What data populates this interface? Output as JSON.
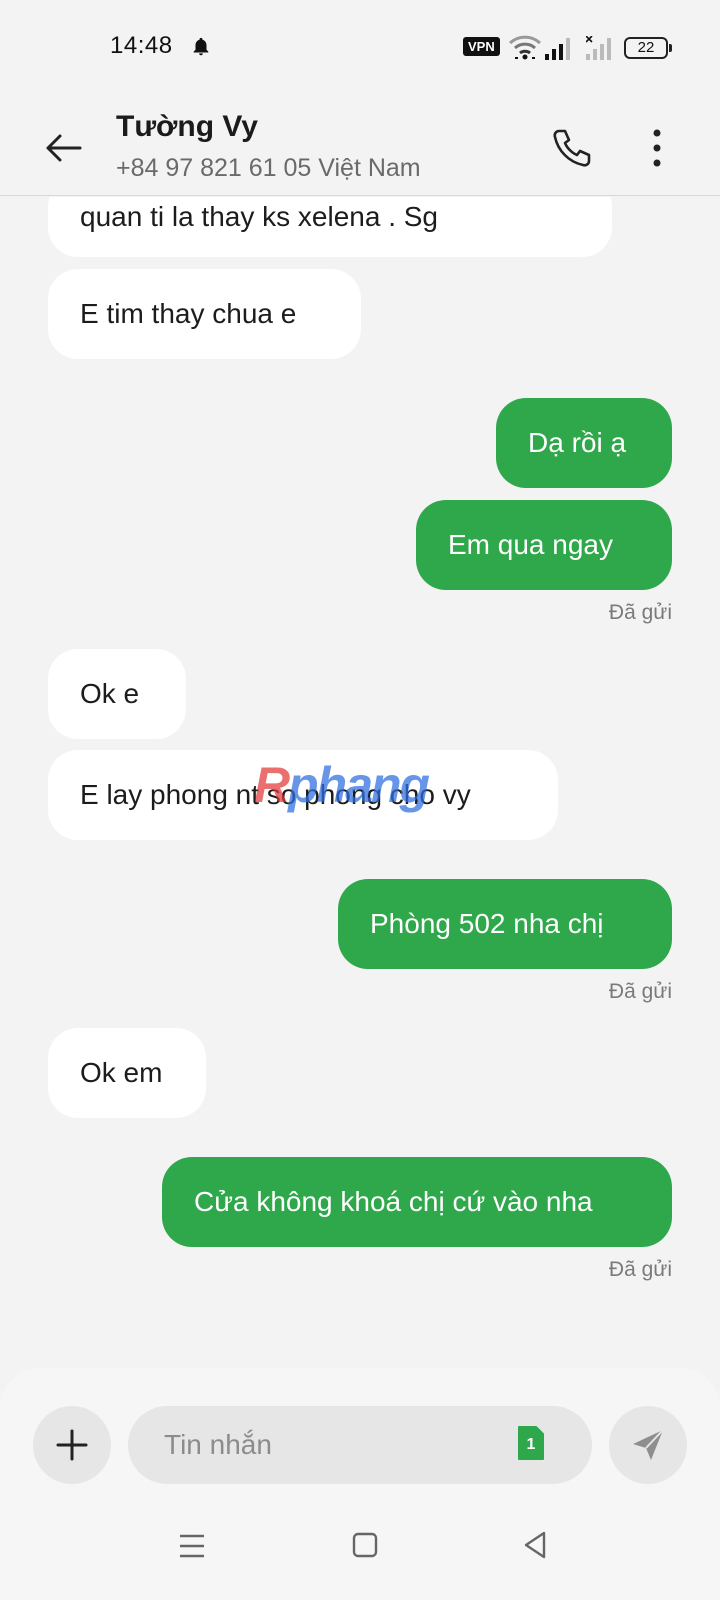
{
  "status_bar": {
    "time": "14:48",
    "vpn": "VPN",
    "battery": "22"
  },
  "header": {
    "contact_name": "Tường Vy",
    "contact_number": "+84 97 821 61 05  Việt Nam"
  },
  "messages": [
    {
      "direction": "in",
      "text": "quan ti la thay ks xelena  . Sg"
    },
    {
      "direction": "in",
      "text": "E tim thay chua e"
    },
    {
      "direction": "out",
      "text": "Dạ rồi ạ"
    },
    {
      "direction": "out",
      "text": "Em qua ngay"
    },
    {
      "direction": "in",
      "text": "Ok e"
    },
    {
      "direction": "in",
      "text": "E lay phong nt so phong cho vy"
    },
    {
      "direction": "out",
      "text": "Phòng 502 nha chị"
    },
    {
      "direction": "in",
      "text": "Ok em"
    },
    {
      "direction": "out",
      "text": "Cửa không khoá chị cứ vào nha"
    }
  ],
  "sent_labels": [
    "Đã gửi",
    "Đã gửi",
    "Đã gửi"
  ],
  "watermark": {
    "part1": "R",
    "part2": "phang"
  },
  "composer": {
    "placeholder": "Tin nhắn",
    "sim_slot": "1"
  },
  "icons": {
    "back": "arrow-left-icon",
    "call": "phone-icon",
    "more": "more-vertical-icon",
    "add": "plus-icon",
    "send": "send-icon",
    "sim": "sim-card-icon"
  },
  "colors": {
    "outgoing_bubble": "#2ea84a",
    "incoming_bubble": "#ffffff",
    "background": "#f3f3f3"
  }
}
